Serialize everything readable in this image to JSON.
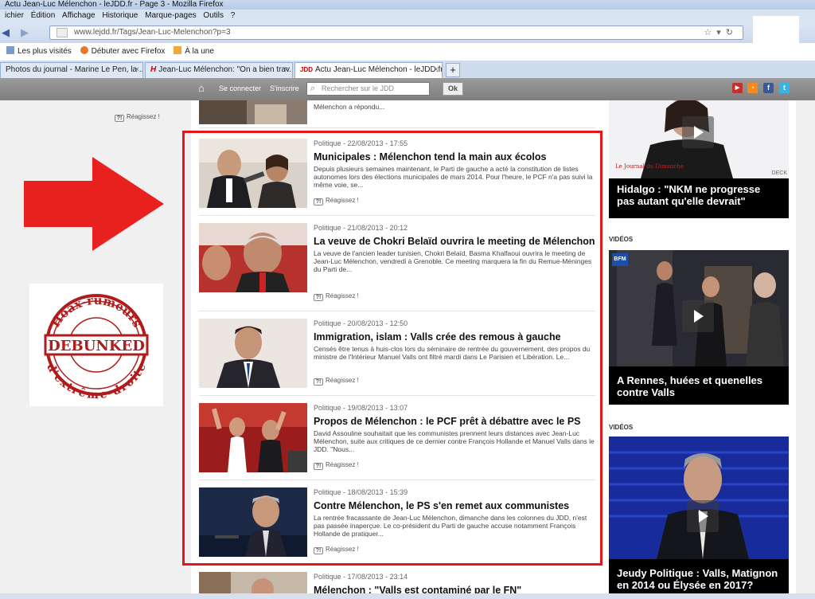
{
  "browser": {
    "title": "Actu Jean-Luc Mélenchon - leJDD.fr - Page 3 - Mozilla Firefox",
    "menu": [
      "ichier",
      "Édition",
      "Affichage",
      "Historique",
      "Marque-pages",
      "Outils",
      "?"
    ],
    "url": "www.lejdd.fr/Tags/Jean-Luc-Melenchon?p=3",
    "bookmarks": [
      "Les plus visités",
      "Débuter avec Firefox",
      "À la une"
    ],
    "tabs": [
      "Photos du journal - Marine Le Pen, la ...",
      "Jean-Luc Mélenchon: \"On a bien trav...",
      "Actu Jean-Luc Mélenchon - leJDD.fr - ..."
    ],
    "new_tab": "+"
  },
  "site": {
    "connect": "Se connecter",
    "register": "S'inscrire",
    "search_placeholder": "Rechercher sur le JDD",
    "ok": "Ok",
    "top_excerpt": "Mélenchon a répondu...",
    "react_label": "Réagissez !"
  },
  "stamp": {
    "top": "Hoax-rumeurs",
    "center": "DEBUNKED",
    "bottom": "d'extrême-droite"
  },
  "articles": [
    {
      "meta": "Politique - 22/08/2013 - 17:55",
      "title": "Municipales : Mélenchon tend la main aux écolos",
      "excerpt": "Depuis plusieurs semaines maintenant, le Parti de gauche a acté la constitution de listes autonomes lors des élections municipales de mars 2014. Pour l'heure, le PCF n'a pas suivi la même voie, se..."
    },
    {
      "meta": "Politique - 21/08/2013 - 20:12",
      "title": "La veuve de Chokri Belaïd ouvrira le meeting de Mélenchon",
      "excerpt": "La veuve de l'ancien leader tunisien, Chokri Belaïd, Basma Khalfaoui ouvrira le meeting de Jean-Luc Mélenchon, vendredi à Grenoble. Ce meeting marquera la fin du Remue-Méninges du Parti de..."
    },
    {
      "meta": "Politique - 20/08/2013 - 12:50",
      "title": "Immigration, islam : Valls crée des remous à gauche",
      "excerpt": "Censés être tenus à huis-clos lors du séminaire de rentrée du gouvernement, des propos du ministre de l'Intérieur Manuel Valls ont filtré mardi dans Le Parisien et Libération. Le..."
    },
    {
      "meta": "Politique - 19/08/2013 - 13:07",
      "title": "Propos de Mélenchon : le PCF prêt à débattre avec le PS",
      "excerpt": "David Assouline souhaitait que les communistes prennent leurs distances avec Jean-Luc Mélenchon, suite aux critiques de ce dernier contre François Hollande et Manuel Valls dans le JDD. \"Nous..."
    },
    {
      "meta": "Politique - 18/08/2013 - 15:39",
      "title": "Contre Mélenchon, le PS s'en remet aux communistes",
      "excerpt": "La rentrée fracassante de Jean-Luc Mélenchon, dimanche dans les colonnes du JDD, n'est pas passée inaperçue. Le co-président du Parti de gauche accuse notamment François Hollande de pratiquer..."
    },
    {
      "meta": "Politique - 17/08/2013 - 23:14",
      "title": "Mélenchon : \"Valls est contaminé par le FN\"",
      "excerpt": ""
    }
  ],
  "sidebar": {
    "videos_label": "VIDÉOS",
    "deck_label": "DECK",
    "bfm_label": "BFM",
    "captions": [
      "Hidalgo : \"NKM ne progresse pas autant qu'elle devrait\"",
      "A Rennes, huées et quenelles contre Valls",
      "Jeudy Politique : Valls, Matignon en 2014 ou Élysée en 2017?"
    ],
    "journal_label": "Le Journal du Dimanche"
  }
}
